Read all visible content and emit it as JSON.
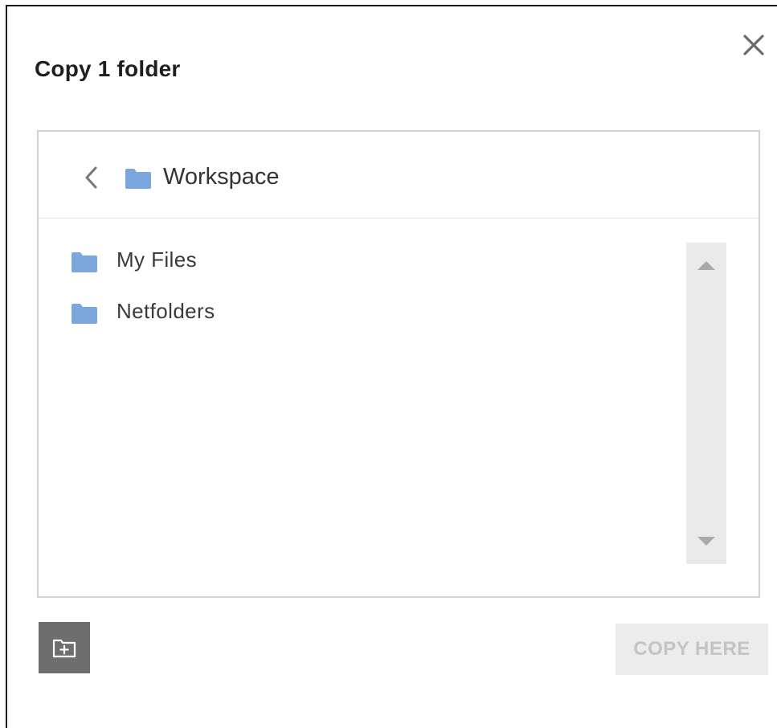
{
  "dialog": {
    "title": "Copy 1 folder",
    "close_icon": "close-icon"
  },
  "browser": {
    "current_folder": "Workspace",
    "back_icon": "chevron-left-icon",
    "folder_icon": "folder-icon",
    "folders": [
      {
        "label": "My Files",
        "icon": "folder-icon"
      },
      {
        "label": "Netfolders",
        "icon": "folder-icon"
      }
    ],
    "scroll_up_icon": "triangle-up-icon",
    "scroll_down_icon": "triangle-down-icon"
  },
  "footer": {
    "new_folder_icon": "new-folder-icon",
    "copy_here_label": "COPY HERE",
    "copy_here_disabled": true
  },
  "colors": {
    "folder": "#7ba7dc",
    "new_folder_button": "#6e6e6e",
    "disabled_button_bg": "#ececec",
    "disabled_button_text": "#c4c4c4"
  }
}
